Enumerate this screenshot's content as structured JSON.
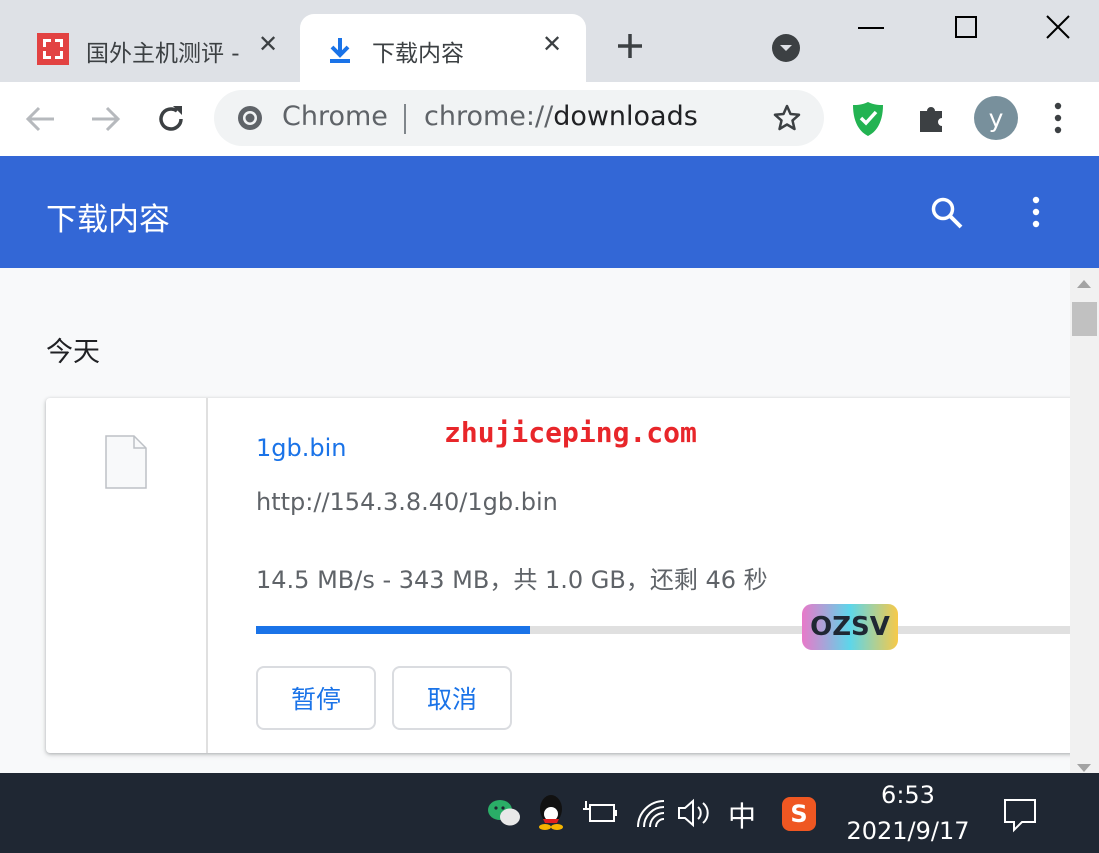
{
  "tabs": [
    {
      "title": "国外主机测评 - ",
      "active": false
    },
    {
      "title": "下载内容",
      "active": true
    }
  ],
  "omnibox": {
    "site_chip": "Chrome",
    "url_scheme": "chrome://",
    "url_path": "downloads"
  },
  "profile": {
    "initial": "y"
  },
  "downloads_page": {
    "title": "下载内容",
    "section_date": "今天"
  },
  "download_item": {
    "file_name": "1gb.bin",
    "url": "http://154.3.8.40/1gb.bin",
    "status": "14.5 MB/s - 343 MB，共 1.0 GB，还剩 46 秒",
    "progress_fraction": 0.33,
    "pause_label": "暂停",
    "cancel_label": "取消"
  },
  "watermarks": {
    "site_text": "zhujiceping.com",
    "sticker_text": "OZSV"
  },
  "taskbar": {
    "ime_label": "中",
    "sogou_label": "S",
    "time": "6:53",
    "date": "2021/9/17"
  },
  "colors": {
    "accent": "#3367d6",
    "link": "#1a73e8",
    "progress": "#1a73e8",
    "watermark": "#e8262a",
    "shield": "#23b352"
  },
  "icons": [
    "chrome-logo-icon",
    "download-icon",
    "close-icon",
    "new-tab-icon",
    "tab-search-icon",
    "minimize-icon",
    "maximize-icon",
    "window-close-icon",
    "back-icon",
    "forward-icon",
    "reload-icon",
    "bookmark-star-icon",
    "adguard-shield-icon",
    "extensions-icon",
    "menu-kebab-icon",
    "search-icon",
    "file-icon",
    "wechat-icon",
    "qq-icon",
    "battery-icon",
    "wifi-icon",
    "volume-icon",
    "notification-icon"
  ]
}
